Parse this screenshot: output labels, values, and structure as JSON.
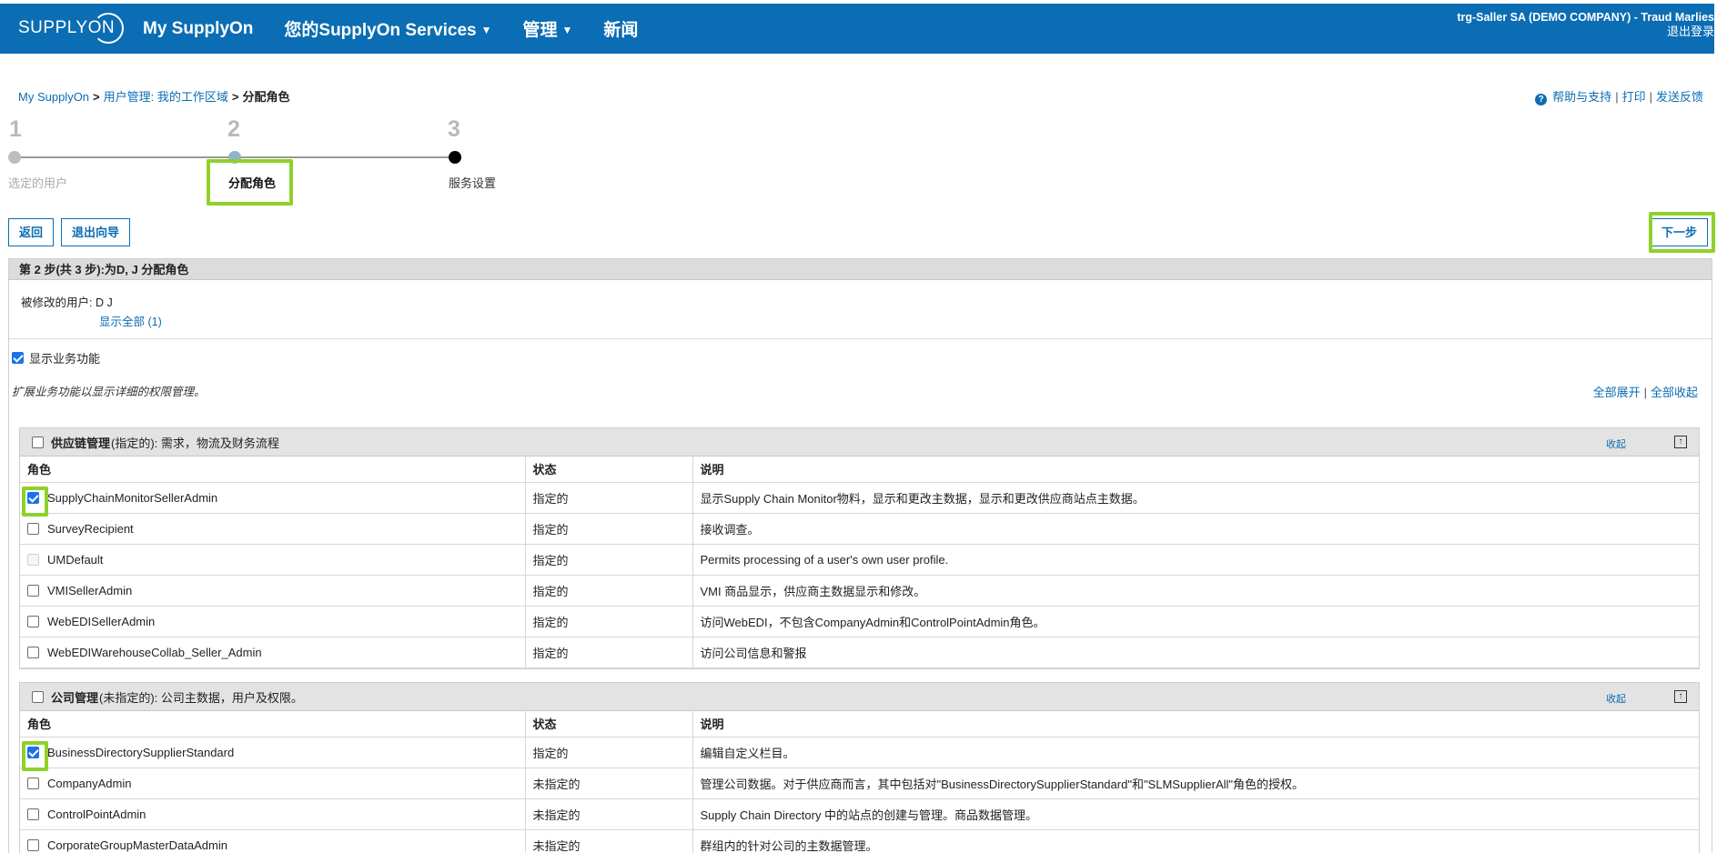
{
  "header": {
    "logo": "SUPPLYON",
    "nav": [
      {
        "label": "My SupplyOn",
        "caret": ""
      },
      {
        "label": "您的SupplyOn Services",
        "caret": "▼"
      },
      {
        "label": "管理",
        "caret": "▼"
      },
      {
        "label": "新闻",
        "caret": ""
      }
    ],
    "account": "trg-Saller SA (DEMO COMPANY) - Traud Marlies",
    "logout": "退出登录"
  },
  "breadcrumb": {
    "items": [
      "My SupplyOn",
      "用户管理: 我的工作区域"
    ],
    "sep": ">",
    "current": "分配角色"
  },
  "help_links": {
    "help": "帮助与支持",
    "print": "打印",
    "feedback": "发送反馈",
    "sep": "|",
    "icon": "question-circle-icon"
  },
  "stepper": {
    "steps": [
      {
        "num": "1",
        "label": "选定的用户",
        "state": "done"
      },
      {
        "num": "2",
        "label": "分配角色",
        "state": "active"
      },
      {
        "num": "3",
        "label": "服务设置",
        "state": "todo"
      }
    ]
  },
  "buttons": {
    "back": "返回",
    "exit": "退出向导",
    "next": "下一步"
  },
  "panel": {
    "title": "第 2 步(共 3 步):为D, J 分配角色",
    "modified_user_label": "被修改的用户: D J",
    "show_all": "显示全部 (1)"
  },
  "show_business": {
    "label": "显示业务功能",
    "checked": true
  },
  "note": "扩展业务功能以显示详细的权限管理。",
  "expand": {
    "expand_all": "全部展开",
    "collapse_all": "全部收起",
    "sep": "|"
  },
  "columns": {
    "role": "角色",
    "status": "状态",
    "desc": "说明"
  },
  "groups": [
    {
      "title": "供应链管理",
      "subtitle": "(指定的): 需求，物流及财务流程",
      "collapse": "收起",
      "top_icon": "arrow-up-to-top-icon",
      "rows": [
        {
          "role": "SupplyChainMonitorSellerAdmin",
          "status": "指定的",
          "desc": "显示Supply Chain Monitor物料，显示和更改主数据，显示和更改供应商站点主数据。",
          "checked": true,
          "disabled": false
        },
        {
          "role": "SurveyRecipient",
          "status": "指定的",
          "desc": "接收调查。",
          "checked": false,
          "disabled": false
        },
        {
          "role": "UMDefault",
          "status": "指定的",
          "desc": "Permits processing of a user's own user profile.",
          "checked": false,
          "disabled": true
        },
        {
          "role": "VMISellerAdmin",
          "status": "指定的",
          "desc": "VMI 商品显示，供应商主数据显示和修改。",
          "checked": false,
          "disabled": false
        },
        {
          "role": "WebEDISellerAdmin",
          "status": "指定的",
          "desc": "访问WebEDI，不包含CompanyAdmin和ControlPointAdmin角色。",
          "checked": false,
          "disabled": false
        },
        {
          "role": "WebEDIWarehouseCollab_Seller_Admin",
          "status": "指定的",
          "desc": "访问公司信息和警报",
          "checked": false,
          "disabled": false
        }
      ]
    },
    {
      "title": "公司管理",
      "subtitle": "(未指定的): 公司主数据，用户及权限。",
      "collapse": "收起",
      "top_icon": "arrow-up-to-top-icon",
      "rows": [
        {
          "role": "BusinessDirectorySupplierStandard",
          "status": "指定的",
          "desc": "编辑自定义栏目。",
          "checked": true,
          "disabled": false
        },
        {
          "role": "CompanyAdmin",
          "status": "未指定的",
          "desc": "管理公司数据。对于供应商而言，其中包括对\"BusinessDirectorySupplierStandard\"和\"SLMSupplierAll\"角色的授权。",
          "checked": false,
          "disabled": false
        },
        {
          "role": "ControlPointAdmin",
          "status": "未指定的",
          "desc": "Supply Chain Directory 中的站点的创建与管理。商品数据管理。",
          "checked": false,
          "disabled": false
        },
        {
          "role": "CorporateGroupMasterDataAdmin",
          "status": "未指定的",
          "desc": "群组内的针对公司的主数据管理。",
          "checked": false,
          "disabled": false
        }
      ]
    }
  ]
}
